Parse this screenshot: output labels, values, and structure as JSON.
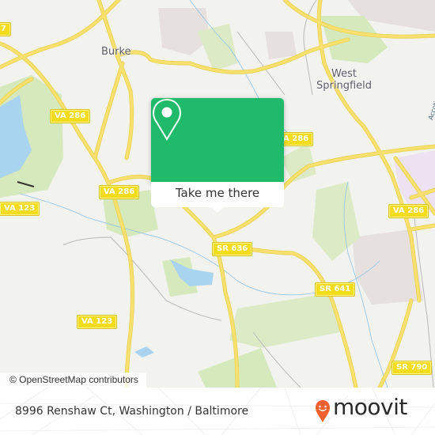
{
  "map": {
    "place_labels": [
      {
        "name": "Burke"
      },
      {
        "name": "West Springfield",
        "line1": "West",
        "line2": "Springfield"
      }
    ],
    "road_shields": [
      "VA 286",
      "VA 286",
      "VA 286",
      "VA 286",
      "VA 123",
      "VA 123",
      "SR 636",
      "SR 641",
      "SR 790",
      "7"
    ],
    "waterway_label": "Accotink Creek",
    "attribution": "© OpenStreetMap contributors",
    "colors": {
      "land": "#f2f2ee",
      "park": "#d6e9bc",
      "water": "#a9d4ef",
      "road_major": "#f7e06e",
      "road_minor": "#b8b8b8",
      "residential": "#e6e0de",
      "commercial": "#ece2f1"
    }
  },
  "popup": {
    "button_label": "Take me there",
    "color": "#1fbb6a",
    "icon": "map-pin-icon"
  },
  "footer": {
    "address": "8996 Renshaw Ct, Washington / Baltimore",
    "brand": "moovit",
    "brand_color": "#f2612f"
  }
}
